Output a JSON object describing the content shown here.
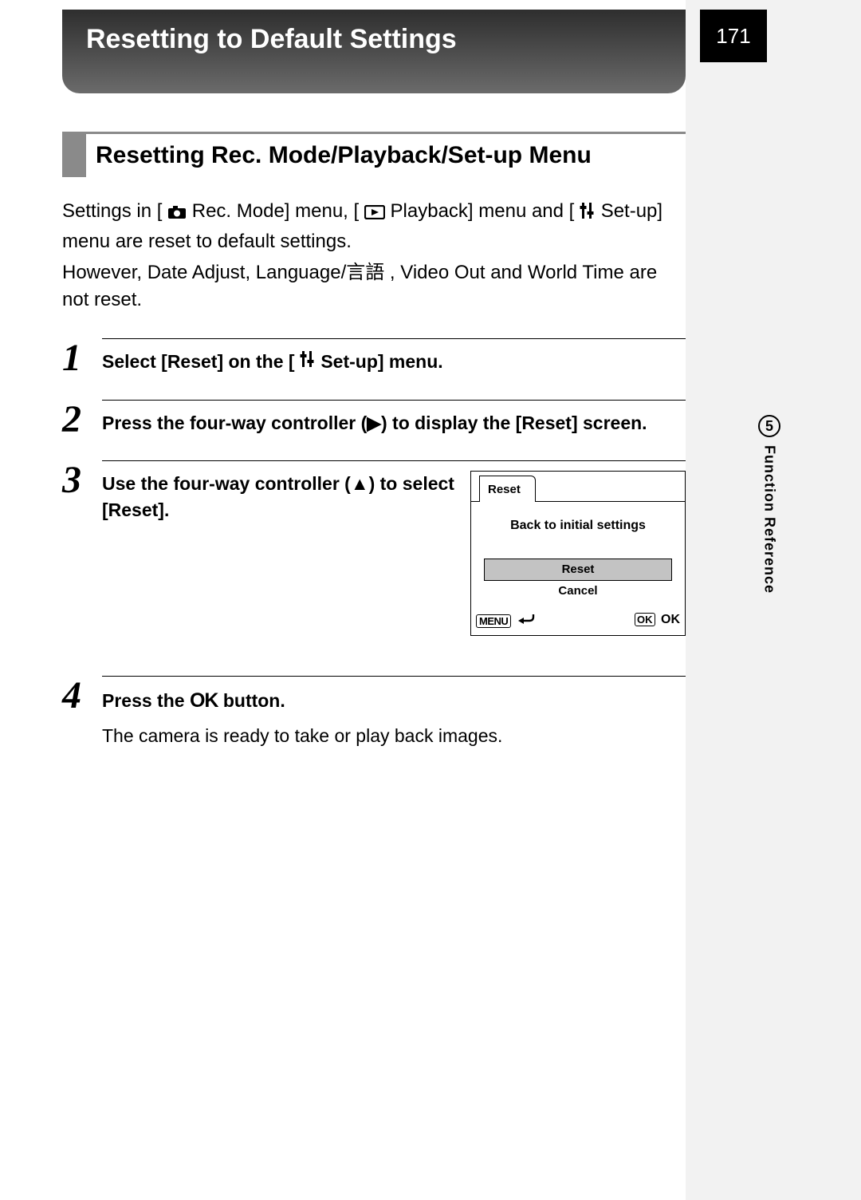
{
  "page_number": "171",
  "header_title": "Resetting to Default Settings",
  "section_title": "Resetting Rec. Mode/Playback/Set-up Menu",
  "intro": {
    "part1": "Settings in [",
    "rec_mode": " Rec. Mode] menu, [",
    "playback": " Playback] menu and [",
    "setup": " Set-up] menu are reset to default settings.",
    "line2": "However, Date Adjust, Language/言語 , Video Out and World Time are not reset."
  },
  "steps": [
    {
      "num": "1",
      "instruction_a": "Select [Reset] on the [",
      "instruction_b": " Set-up] menu."
    },
    {
      "num": "2",
      "instruction": "Press the four-way controller (▶) to display the [Reset] screen."
    },
    {
      "num": "3",
      "instruction": "Use the four-way controller (▲) to select [Reset]."
    },
    {
      "num": "4",
      "instruction_a": "Press the ",
      "instruction_b": " button.",
      "note": "The camera is ready to take or play back images."
    }
  ],
  "lcd": {
    "tab": "Reset",
    "message": "Back to initial settings",
    "option_selected": "Reset",
    "option_other": "Cancel",
    "menu_label": "MENU",
    "ok_label": "OK",
    "ok_text": "OK"
  },
  "side": {
    "chapter": "5",
    "label": "Function Reference"
  },
  "ok_glyph": "OK"
}
